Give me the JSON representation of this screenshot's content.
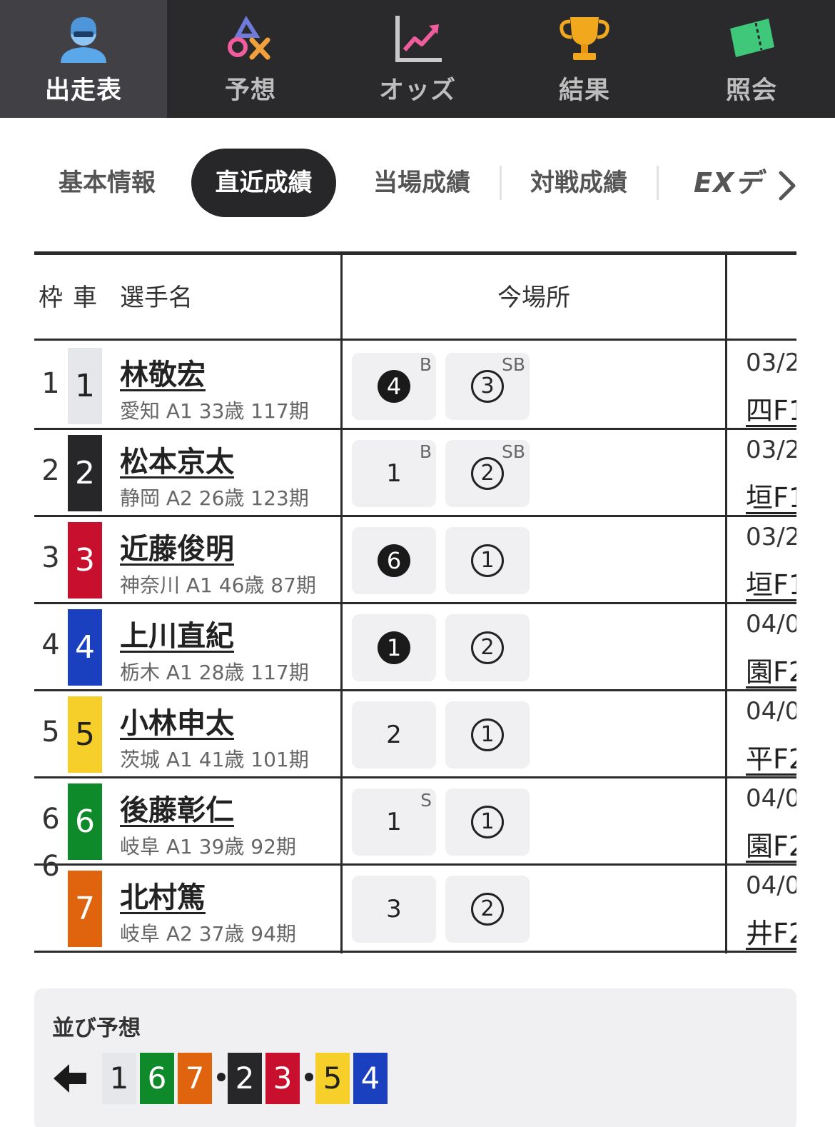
{
  "nav": {
    "items": [
      {
        "label": "出走表",
        "icon": "person-helmet-icon"
      },
      {
        "label": "予想",
        "icon": "prediction-marks-icon"
      },
      {
        "label": "オッズ",
        "icon": "chart-up-icon"
      },
      {
        "label": "結果",
        "icon": "trophy-icon"
      },
      {
        "label": "照会",
        "icon": "ticket-icon"
      }
    ]
  },
  "subtabs": {
    "items": [
      "基本情報",
      "直近成績",
      "当場成績",
      "対戦成績"
    ],
    "ex_label": "EXデ",
    "active": "直近成績"
  },
  "table": {
    "headers": {
      "waku": "枠",
      "car": "車",
      "name": "選手名",
      "venue": "今場所"
    },
    "rows": [
      {
        "waku": "1",
        "car": "1",
        "name": "林敬宏",
        "info": "愛知 A1 33歳 117期",
        "r1": {
          "num": "4",
          "style": "filled",
          "tag": "B"
        },
        "r2": {
          "num": "3",
          "style": "circle",
          "tag": "SB"
        },
        "date": "03/2",
        "venue": "四F1"
      },
      {
        "waku": "2",
        "car": "2",
        "name": "松本京太",
        "info": "静岡 A2 26歳 123期",
        "r1": {
          "num": "1",
          "style": "plain",
          "tag": "B"
        },
        "r2": {
          "num": "2",
          "style": "circle",
          "tag": "SB"
        },
        "date": "03/2",
        "venue": "垣F1"
      },
      {
        "waku": "3",
        "car": "3",
        "name": "近藤俊明",
        "info": "神奈川 A1 46歳 87期",
        "r1": {
          "num": "6",
          "style": "filled",
          "tag": ""
        },
        "r2": {
          "num": "1",
          "style": "circle",
          "tag": ""
        },
        "date": "03/2",
        "venue": "垣F1"
      },
      {
        "waku": "4",
        "car": "4",
        "name": "上川直紀",
        "info": "栃木 A1 28歳 117期",
        "r1": {
          "num": "1",
          "style": "filled",
          "tag": ""
        },
        "r2": {
          "num": "2",
          "style": "circle",
          "tag": ""
        },
        "date": "04/0",
        "venue": "園F2"
      },
      {
        "waku": "5",
        "car": "5",
        "name": "小林申太",
        "info": "茨城 A1 41歳 101期",
        "r1": {
          "num": "2",
          "style": "plain",
          "tag": ""
        },
        "r2": {
          "num": "1",
          "style": "circle",
          "tag": ""
        },
        "date": "04/0",
        "venue": "平F2"
      },
      {
        "waku": "6",
        "car": "6",
        "name": "後藤彰仁",
        "info": "岐阜 A1 39歳 92期",
        "r1": {
          "num": "1",
          "style": "plain",
          "tag": "S"
        },
        "r2": {
          "num": "1",
          "style": "circle",
          "tag": ""
        },
        "date": "04/0",
        "venue": "園F2"
      },
      {
        "waku": "",
        "car": "7",
        "name": "北村篤",
        "info": "岐阜 A2 37歳 94期",
        "r1": {
          "num": "3",
          "style": "plain",
          "tag": ""
        },
        "r2": {
          "num": "2",
          "style": "circle",
          "tag": ""
        },
        "date": "04/0",
        "venue": "井F2"
      }
    ],
    "shared_waku": "6"
  },
  "car_colors": {
    "1": {
      "bg": "#e6e7ea",
      "fg": "#222222"
    },
    "2": {
      "bg": "#27272a",
      "fg": "#ffffff"
    },
    "3": {
      "bg": "#c8102e",
      "fg": "#ffffff"
    },
    "4": {
      "bg": "#1a3fbf",
      "fg": "#ffffff"
    },
    "5": {
      "bg": "#f7cf2b",
      "fg": "#222222"
    },
    "6": {
      "bg": "#0f8a2a",
      "fg": "#ffffff"
    },
    "7": {
      "bg": "#e0640e",
      "fg": "#ffffff"
    }
  },
  "prediction": {
    "title": "並び予想",
    "arrow_icon": "arrow-left-icon",
    "groups": [
      [
        "1",
        "6",
        "7"
      ],
      [
        "2",
        "3"
      ],
      [
        "5",
        "4"
      ]
    ]
  }
}
